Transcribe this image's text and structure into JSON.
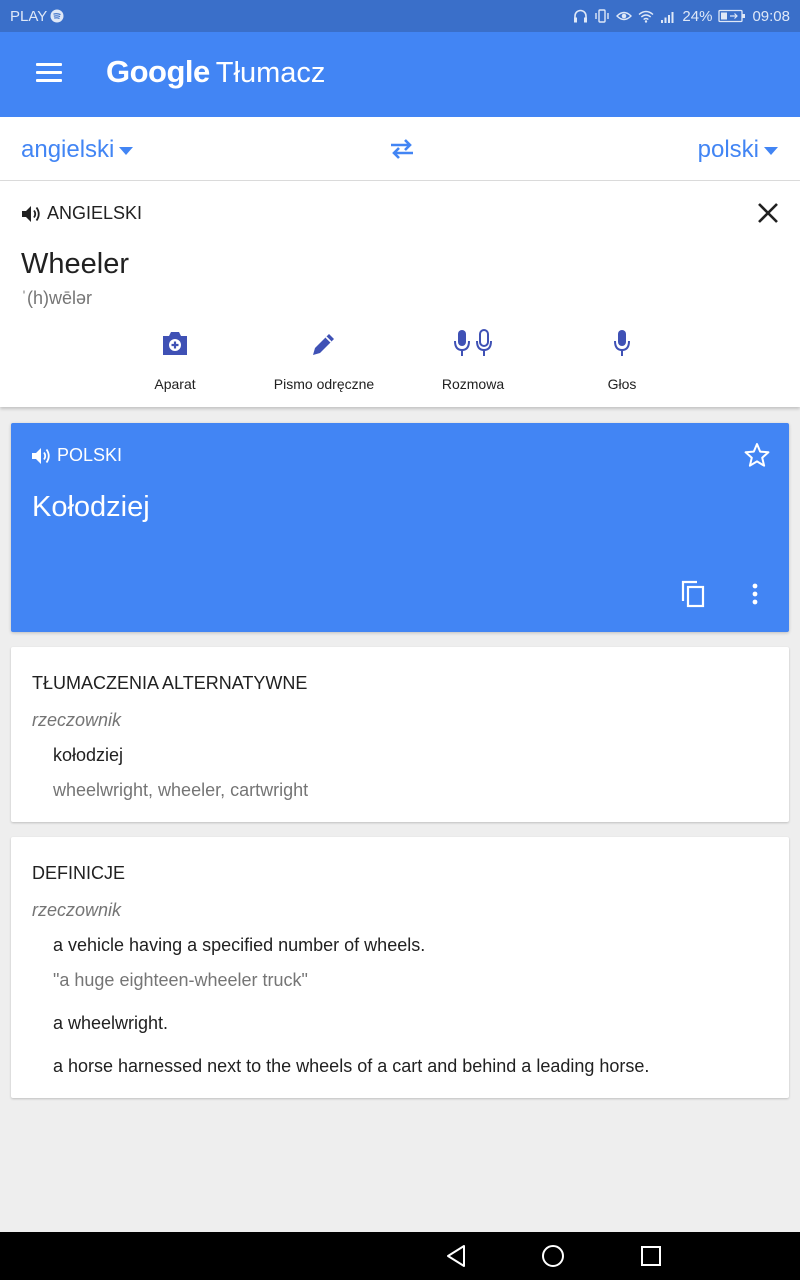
{
  "status_bar": {
    "carrier": "PLAY",
    "battery": "24%",
    "time": "09:08",
    "icons": [
      "spotify-icon",
      "headphones-icon",
      "vibrate-icon",
      "eye-icon",
      "wifi-icon",
      "signal-icon",
      "battery-icon"
    ]
  },
  "app_bar": {
    "brand_google": "Google",
    "brand_product": "Tłumacz",
    "icons": [
      "menu-icon"
    ]
  },
  "language_bar": {
    "source_language": "angielski",
    "target_language": "polski",
    "icons": [
      "swap-icon",
      "caret-down-icon"
    ]
  },
  "input": {
    "language_label": "ANGIELSKI",
    "text": "Wheeler",
    "phonetic": "ˈ(h)wēlər",
    "tools": [
      {
        "label": "Aparat",
        "icon": "camera-icon"
      },
      {
        "label": "Pismo odręczne",
        "icon": "pen-icon"
      },
      {
        "label": "Rozmowa",
        "icon": "conversation-mic-icon"
      },
      {
        "label": "Głos",
        "icon": "mic-icon"
      }
    ]
  },
  "translation": {
    "language_label": "POLSKI",
    "text": "Kołodziej",
    "icons": [
      "speaker-icon",
      "star-icon",
      "copy-icon",
      "more-vert-icon"
    ]
  },
  "alternatives": {
    "heading": "TŁUMACZENIA ALTERNATYWNE",
    "part_of_speech": "rzeczownik",
    "term": "kołodziej",
    "synonyms": "wheelwright, wheeler, cartwright"
  },
  "definitions": {
    "heading": "DEFINICJE",
    "part_of_speech": "rzeczownik",
    "items": [
      {
        "text": "a vehicle having a specified number of wheels.",
        "example": "\"a huge eighteen-wheeler truck\""
      },
      {
        "text": "a wheelwright."
      },
      {
        "text": "a horse harnessed next to the wheels of a cart and behind a leading horse."
      }
    ]
  },
  "nav_bar": {
    "icons": [
      "back-icon",
      "home-icon",
      "recents-icon"
    ]
  },
  "colors": {
    "primary": "#4285f4",
    "status_bar": "#3a6fc9",
    "tool_icon": "#3f51b5",
    "background": "#eeeeee"
  }
}
